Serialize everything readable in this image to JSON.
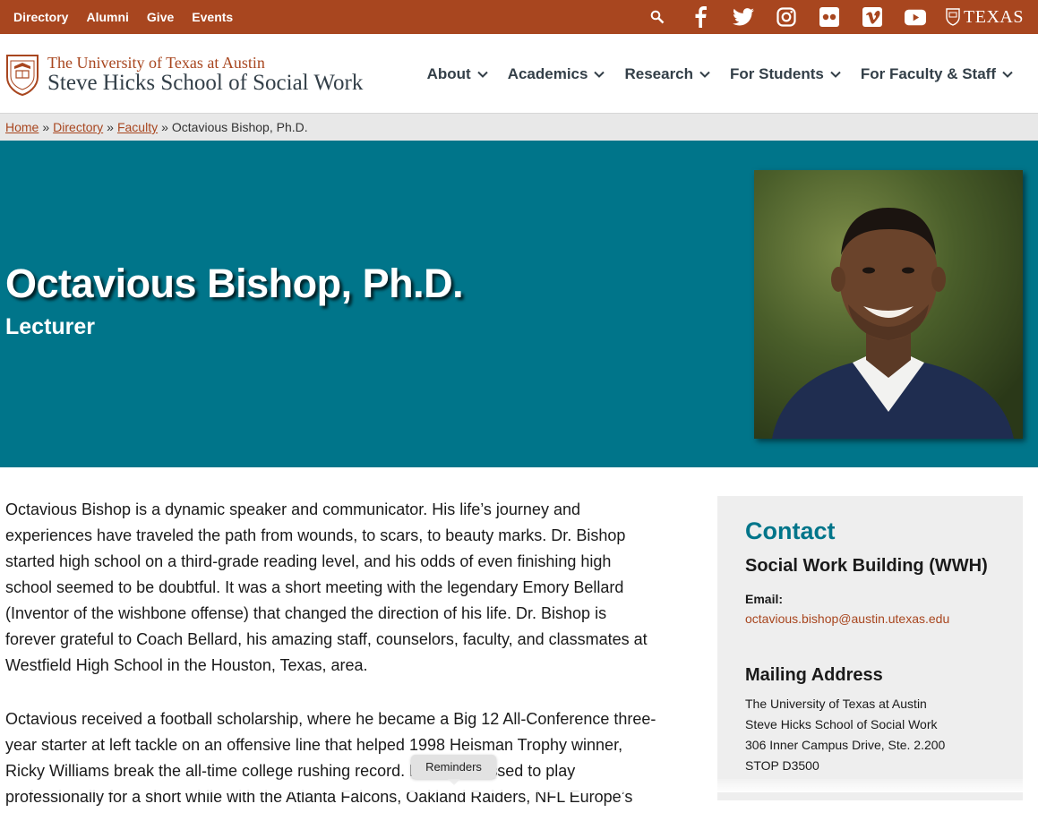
{
  "topbar": {
    "links": [
      "Directory",
      "Alumni",
      "Give",
      "Events"
    ],
    "icons": [
      "search-icon",
      "facebook-icon",
      "twitter-icon",
      "instagram-icon",
      "flickr-icon",
      "vimeo-icon",
      "youtube-icon"
    ],
    "texas_logo": "TEXAS",
    "color": "#a8461f"
  },
  "header": {
    "brand_line1": "The University of Texas at Austin",
    "brand_line2": "Steve Hicks School of Social Work",
    "nav": [
      "About",
      "Academics",
      "Research",
      "For Students",
      "For Faculty & Staff"
    ]
  },
  "breadcrumb": {
    "items": [
      "Home",
      "Directory",
      "Faculty"
    ],
    "separator": "»",
    "current": "Octavious Bishop, Ph.D."
  },
  "hero": {
    "name": "Octavious Bishop, Ph.D.",
    "role": "Lecturer",
    "color": "#00758a"
  },
  "bio": {
    "paragraphs": [
      "Octavious Bishop is a dynamic speaker and communicator. His life’s journey and experiences have traveled the path from wounds, to scars, to beauty marks. Dr. Bishop started high school on a third-grade reading level, and his odds of even finishing high school seemed to be doubtful. It was a short meeting with the legendary Emory Bellard (Inventor of the wishbone offense) that changed the direction of his life. Dr. Bishop is forever grateful to Coach Bellard, his amazing staff, counselors, faculty, and classmates at Westfield High School in the Houston, Texas, area.",
      "Octavious received a football scholarship, where he became a Big 12 All-Conference three-year starter at left tackle on an offensive line that helped 1998 Heisman Trophy winner, Ricky Williams break the all-time college rushing record. He was blessed to play professionally for a short while with the Atlanta Falcons, Oakland Raiders, NFL Europe’s"
    ]
  },
  "contact": {
    "heading": "Contact",
    "building": "Social Work Building (WWH)",
    "email_label": "Email:",
    "email": "octavious.bishop@austin.utexas.edu",
    "mailing_heading": "Mailing Address",
    "address": [
      "The University of Texas at Austin",
      "Steve Hicks School of Social Work",
      "306 Inner Campus Drive, Ste. 2.200",
      "STOP D3500"
    ]
  },
  "tooltip": "Reminders"
}
